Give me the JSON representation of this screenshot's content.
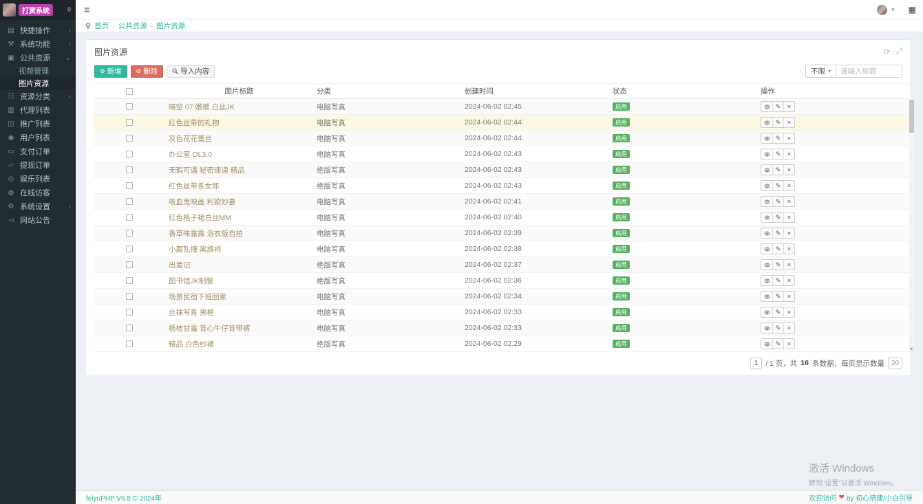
{
  "colors": {
    "accent": "#2fb9a0",
    "danger": "#dd6a5e",
    "badge_green": "#52b35e",
    "highlight_row": "#fcf8e3",
    "title_text": "#a29064",
    "logo_pill": "#bf3eae"
  },
  "icons": {
    "hamburger": "≡",
    "caret_down": "▾",
    "grid_btn": "▦",
    "droplet": "◊",
    "chevron_collapsed": "‹",
    "chevron_expanded": "⌄",
    "add": "⊕",
    "delete": "⊘",
    "pencil": "✎",
    "close": "×",
    "refresh": "⟳",
    "expand": "⤢",
    "scroll_down": "▾",
    "folder": "▤",
    "tools": "⚒",
    "camera": "▣",
    "category": "☷",
    "agents": "▥",
    "promote": "◫",
    "user": "◉",
    "payment": "▭",
    "withdraw": "▱",
    "fun": "◎",
    "visitors": "◍",
    "settings": "⚙",
    "notice": "◅"
  },
  "app": {
    "logo_title": "打赏系统"
  },
  "sidebar": {
    "items": [
      {
        "id": "quick-ops",
        "label": "快捷操作",
        "icon": "folder",
        "icon_name": "folder-icon",
        "chevron": true
      },
      {
        "id": "system-functions",
        "label": "系统功能",
        "icon": "tools",
        "icon_name": "tools-icon",
        "chevron": true
      },
      {
        "id": "public-resources",
        "label": "公共资源",
        "icon": "camera",
        "icon_name": "camera-icon",
        "chevron": true,
        "expanded": true,
        "children": [
          {
            "id": "video-manage",
            "label": "视频管理"
          },
          {
            "id": "image-resources",
            "label": "图片资源",
            "active": true
          }
        ]
      },
      {
        "id": "resource-category",
        "label": "资源分类",
        "icon": "category",
        "icon_name": "grid-icon",
        "chevron": true
      },
      {
        "id": "agent-list",
        "label": "代理列表",
        "icon": "agents",
        "icon_name": "agents-icon"
      },
      {
        "id": "promotion-list",
        "label": "推广列表",
        "icon": "promote",
        "icon_name": "promotion-icon"
      },
      {
        "id": "user-list",
        "label": "用户列表",
        "icon": "user",
        "icon_name": "user-icon"
      },
      {
        "id": "payment-orders",
        "label": "支付订单",
        "icon": "payment",
        "icon_name": "payment-order-icon"
      },
      {
        "id": "withdraw-orders",
        "label": "提现订单",
        "icon": "withdraw",
        "icon_name": "withdraw-order-icon"
      },
      {
        "id": "fun-list",
        "label": "娱乐列表",
        "icon": "fun",
        "icon_name": "entertainment-icon"
      },
      {
        "id": "online-visitors",
        "label": "在线访客",
        "icon": "visitors",
        "icon_name": "visitors-icon"
      },
      {
        "id": "system-settings",
        "label": "系统设置",
        "icon": "settings",
        "icon_name": "gear-icon",
        "chevron": true
      },
      {
        "id": "site-notice",
        "label": "网站公告",
        "icon": "notice",
        "icon_name": "announcement-icon"
      }
    ]
  },
  "breadcrumb": {
    "separator": "›",
    "items": [
      "首页",
      "公共资源",
      "图片资源"
    ]
  },
  "panel": {
    "title": "图片资源"
  },
  "toolbar": {
    "add_label": "新增",
    "delete_label": "删除",
    "import_label": "导入内容",
    "filter_label": "不限",
    "search_placeholder": "请输入标题"
  },
  "table": {
    "headers": {
      "title": "图片标题",
      "category": "分类",
      "created": "创建时间",
      "status": "状态",
      "actions": "操作"
    },
    "rows": [
      {
        "title": "晴空 07 嫩模 白丝JK",
        "category": "电脑写真",
        "created": "2024-06-02 02:45",
        "status": "启用",
        "highlight": false
      },
      {
        "title": "红色丝带的礼物",
        "category": "电脑写真",
        "created": "2024-06-02 02:44",
        "status": "启用",
        "highlight": true
      },
      {
        "title": "灰色花花蕾丝",
        "category": "电脑写真",
        "created": "2024-06-02 02:44",
        "status": "启用",
        "highlight": false
      },
      {
        "title": "办公室 OL3.0",
        "category": "电脑写真",
        "created": "2024-06-02 02:43",
        "status": "启用",
        "highlight": false
      },
      {
        "title": "无瑕可遇 秘密速递 精品",
        "category": "绝版写真",
        "created": "2024-06-02 02:43",
        "status": "启用",
        "highlight": false
      },
      {
        "title": "红色丝带系女郎",
        "category": "绝版写真",
        "created": "2024-06-02 02:43",
        "status": "启用",
        "highlight": false
      },
      {
        "title": "吸血鬼映画 利欲妙妻",
        "category": "电脑写真",
        "created": "2024-06-02 02:41",
        "status": "启用",
        "highlight": false
      },
      {
        "title": "红色格子裙白丝MM",
        "category": "电脑写真",
        "created": "2024-06-02 02:40",
        "status": "启用",
        "highlight": false
      },
      {
        "title": "香草味露露 浴衣版自拍",
        "category": "电脑写真",
        "created": "2024-06-02 02:39",
        "status": "启用",
        "highlight": false
      },
      {
        "title": "小鹿乱撞 黑旗袍",
        "category": "电脑写真",
        "created": "2024-06-02 02:38",
        "status": "启用",
        "highlight": false
      },
      {
        "title": "出差记",
        "category": "绝版写真",
        "created": "2024-06-02 02:37",
        "status": "启用",
        "highlight": false
      },
      {
        "title": "图书馆JK制服",
        "category": "绝版写真",
        "created": "2024-06-02 02:36",
        "status": "启用",
        "highlight": false
      },
      {
        "title": "场景民宿下班回家",
        "category": "电脑写真",
        "created": "2024-06-02 02:34",
        "status": "启用",
        "highlight": false
      },
      {
        "title": "丝袜写真 黑框",
        "category": "电脑写真",
        "created": "2024-06-02 02:33",
        "status": "启用",
        "highlight": false
      },
      {
        "title": "杨枝甘露 背心牛仔背带裤",
        "category": "电脑写真",
        "created": "2024-06-02 02:33",
        "status": "启用",
        "highlight": false
      },
      {
        "title": "精品 白色纱裙",
        "category": "绝版写真",
        "created": "2024-06-02 02:29",
        "status": "启用",
        "highlight": false
      }
    ]
  },
  "pagination": {
    "page": "1",
    "pages_prefix": "/ 1 页，共",
    "total": "16",
    "suffix": "条数据，每页显示数量",
    "page_size": "20"
  },
  "watermark": {
    "line1": "激活 Windows",
    "line2": "转到“设置”以激活 Windows。"
  },
  "footer": {
    "left": "feiyuPHP V6.8 © 2024年",
    "right_prefix": "欢迎访问",
    "heart": "❤",
    "right_suffix": "by 初心搭建/小白引导"
  }
}
